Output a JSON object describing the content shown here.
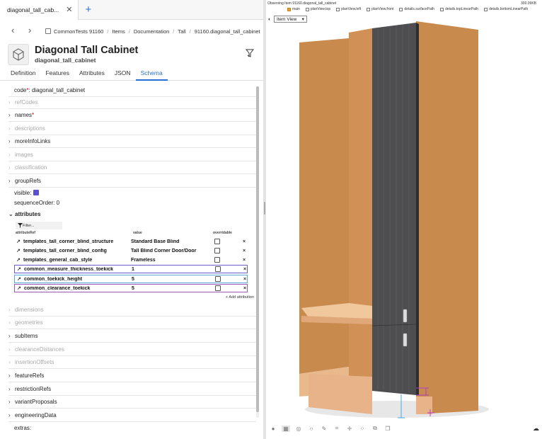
{
  "tab": {
    "title": "diagonal_tall_cab...",
    "close": "✕",
    "new": "+"
  },
  "breadcrumb": [
    "CommonTests 91160",
    "Items",
    "Documentation",
    "Tall",
    "91160.diagonal_tall_cabinet"
  ],
  "header": {
    "title": "Diagonal Tall Cabinet",
    "subtitle": "diagonal_tall_cabinet"
  },
  "subtabs": [
    "Definition",
    "Features",
    "Attributes",
    "JSON",
    "Schema"
  ],
  "code": {
    "label": "code",
    "req": "*",
    "value": "diagonal_tall_cabinet"
  },
  "props": {
    "refCodes": "refCodes",
    "names": "names",
    "names_req": "*",
    "descriptions": "descriptions",
    "moreInfoLinks": "moreInfoLinks",
    "images": "images",
    "classification": "classification",
    "groupRefs": "groupRefs",
    "visible": "visible:",
    "sequenceOrder": "sequenceOrder:",
    "sequenceOrderValue": "0",
    "attributes": "attributes",
    "dimensions": "dimensions",
    "geometries": "geometries",
    "subItems": "subItems",
    "clearanceDistances": "clearanceDistances",
    "insertionOffsets": "insertionOffsets",
    "featureRefs": "featureRefs",
    "restrictionRefs": "restrictionRefs",
    "variantProposals": "variantProposals",
    "engineeringData": "engineeringData",
    "extras": "extras:"
  },
  "attr_table": {
    "filter_placeholder": "Filter...",
    "columns": [
      "attributeRef",
      "value",
      "overridable"
    ],
    "rows": [
      {
        "ref": "templates_tall_corner_blind_structure",
        "value": "Standard Base Blind"
      },
      {
        "ref": "templates_tall_corner_blind_config",
        "value": "Tall Blind Corner Door/Door"
      },
      {
        "ref": "templates_general_cab_style",
        "value": "Frameless"
      },
      {
        "ref": "common_measure_thickness_toekick",
        "value": "1"
      },
      {
        "ref": "common_toekick_height",
        "value": "5"
      },
      {
        "ref": "common_clearance_toekick",
        "value": "5"
      }
    ],
    "add_label": "+ Add attribution"
  },
  "viewer": {
    "observing": "Observing Item 91160.diagonal_tall_cabinet",
    "size": "300.09KB",
    "options": [
      {
        "label": "main",
        "checked": true
      },
      {
        "label": "planView.top",
        "checked": false
      },
      {
        "label": "planView.left",
        "checked": false
      },
      {
        "label": "planView.front",
        "checked": false
      },
      {
        "label": "details.surfacePath",
        "checked": false
      },
      {
        "label": "details.topLinearPath",
        "checked": false
      },
      {
        "label": "details.bottomLinearPath",
        "checked": false
      }
    ],
    "view_mode": "Item View"
  }
}
